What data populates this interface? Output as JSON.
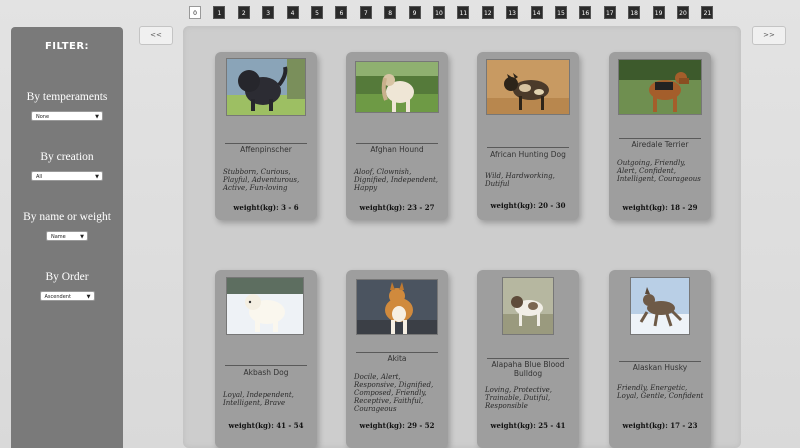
{
  "sidebar": {
    "title": "FILTER:",
    "filters": [
      {
        "label": "By temperaments",
        "selected": "None"
      },
      {
        "label": "By creation",
        "selected": "All"
      },
      {
        "label": "By name or weight",
        "selected": "Name"
      },
      {
        "label": "By Order",
        "selected": "Ascendent"
      }
    ]
  },
  "pagination": {
    "pages": [
      "0",
      "1",
      "2",
      "3",
      "4",
      "5",
      "6",
      "7",
      "8",
      "9",
      "10",
      "11",
      "12",
      "13",
      "14",
      "15",
      "16",
      "17",
      "18",
      "19",
      "20",
      "21"
    ],
    "active": "0"
  },
  "nav": {
    "prev_label": "<<",
    "next_label": ">>"
  },
  "dogs": [
    {
      "name": "Affenpinscher",
      "temperament": "Stubborn, Curious, Playful, Adventurous, Active, Fun-loving",
      "weight": "weight(kg): 3 - 6"
    },
    {
      "name": "Afghan Hound",
      "temperament": "Aloof, Clownish, Dignified, Independent, Happy",
      "weight": "weight(kg): 23 - 27"
    },
    {
      "name": "African Hunting Dog",
      "temperament": "Wild, Hardworking, Dutiful",
      "weight": "weight(kg): 20 - 30"
    },
    {
      "name": "Airedale Terrier",
      "temperament": "Outgoing, Friendly, Alert, Confident, Intelligent, Courageous",
      "weight": "weight(kg): 18 - 29"
    },
    {
      "name": "Akbash Dog",
      "temperament": "Loyal, Independent, Intelligent, Brave",
      "weight": "weight(kg): 41 - 54"
    },
    {
      "name": "Akita",
      "temperament": "Docile, Alert, Responsive, Dignified, Composed, Friendly, Receptive, Faithful, Courageous",
      "weight": "weight(kg): 29 - 52"
    },
    {
      "name": "Alapaha Blue Blood Bulldog",
      "temperament": "Loving, Protective, Trainable, Dutiful, Responsible",
      "weight": "weight(kg): 25 - 41"
    },
    {
      "name": "Alaskan Husky",
      "temperament": "Friendly, Energetic, Loyal, Gentle, Confident",
      "weight": "weight(kg): 17 - 23"
    }
  ]
}
